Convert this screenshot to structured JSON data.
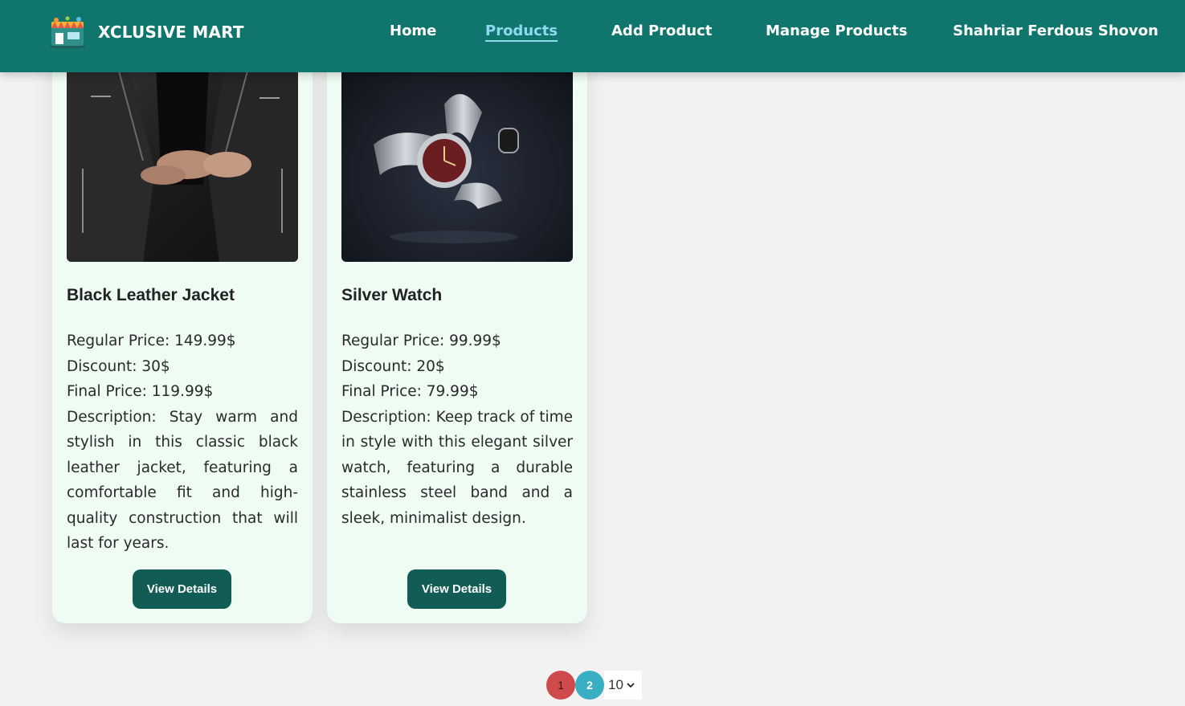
{
  "brand": {
    "name": "XCLUSIVE MART",
    "logo_icon": "store-logo-icon"
  },
  "nav": {
    "home": "Home",
    "products": "Products",
    "add_product": "Add Product",
    "manage_products": "Manage Products",
    "user": "Shahriar Ferdous Shovon",
    "active": "Products"
  },
  "products": [
    {
      "title": "Black Leather Jacket",
      "image_icon": "leather-jacket-image",
      "regular_price": "Regular Price: 149.99$",
      "discount": "Discount: 30$",
      "final_price": "Final Price: 119.99$",
      "description": "Description: Stay warm and stylish in this classic black leather jacket, featuring a comfortable fit and high-quality construction that will last for years.",
      "button": "View Details"
    },
    {
      "title": "Silver Watch",
      "image_icon": "silver-watch-image",
      "regular_price": "Regular Price: 99.99$",
      "discount": "Discount: 20$",
      "final_price": "Final Price: 79.99$",
      "description": "Description: Keep track of time in style with this elegant silver watch, featuring a durable stainless steel band and a sleek, minimalist design.",
      "button": "View Details"
    }
  ],
  "pagination": {
    "pages": [
      "1",
      "2"
    ],
    "current": "2",
    "per_page": "10"
  },
  "colors": {
    "navbar": "#10766d",
    "active_link": "#8fd9f0",
    "card_bg": "#eefcf3",
    "button": "#125c56",
    "page_1": "#cf4a4a",
    "page_2_active": "#3aaec3"
  }
}
